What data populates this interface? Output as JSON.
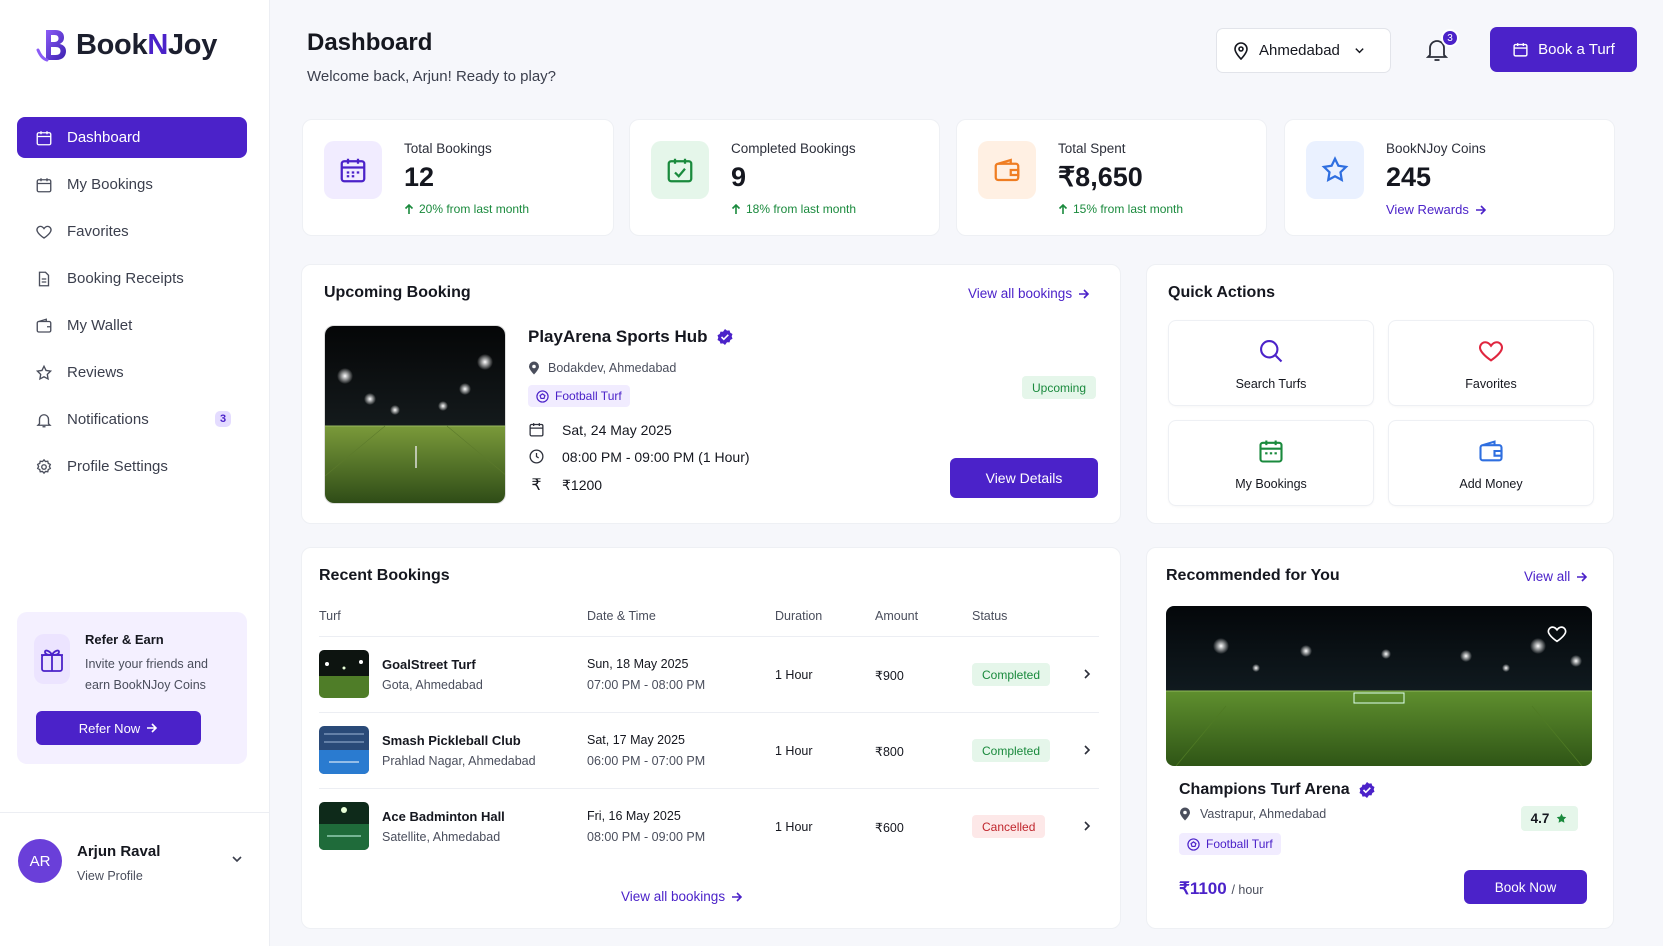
{
  "app": {
    "brand_prefix": "Book",
    "brand_n": "N",
    "brand_suffix": "Joy"
  },
  "sidebar": {
    "items": [
      {
        "label": "Dashboard",
        "icon": "calendar-icon"
      },
      {
        "label": "My Bookings",
        "icon": "calendar-icon"
      },
      {
        "label": "Favorites",
        "icon": "heart-icon"
      },
      {
        "label": "Booking Receipts",
        "icon": "receipt-icon"
      },
      {
        "label": "My Wallet",
        "icon": "wallet-icon"
      },
      {
        "label": "Reviews",
        "icon": "star-icon"
      },
      {
        "label": "Notifications",
        "icon": "bell-icon",
        "badge": "3"
      },
      {
        "label": "Profile Settings",
        "icon": "gear-icon"
      }
    ],
    "refer": {
      "title": "Refer & Earn",
      "text": "Invite your friends and earn BookNJoy Coins",
      "button": "Refer Now"
    },
    "user": {
      "initials": "AR",
      "name": "Arjun Raval",
      "link": "View Profile"
    }
  },
  "header": {
    "title": "Dashboard",
    "subtitle": "Welcome back, Arjun! Ready to play?",
    "location": "Ahmedabad",
    "notif_count": "3",
    "book_button": "Book a Turf"
  },
  "stats": [
    {
      "label": "Total Bookings",
      "value": "12",
      "change": "20% from last month"
    },
    {
      "label": "Completed Bookings",
      "value": "9",
      "change": "18% from last month"
    },
    {
      "label": "Total Spent",
      "value": "₹8,650",
      "change": "15% from last month"
    },
    {
      "label": "BookNJoy Coins",
      "value": "245",
      "link": "View Rewards"
    }
  ],
  "upcoming": {
    "title": "Upcoming Booking",
    "view_all": "View all bookings",
    "name": "PlayArena Sports Hub",
    "location": "Bodakdev, Ahmedabad",
    "tag": "Football Turf",
    "status": "Upcoming",
    "date": "Sat, 24 May 2025",
    "time": "08:00 PM - 09:00 PM (1 Hour)",
    "price": "₹1200",
    "button": "View Details"
  },
  "quick_actions": {
    "title": "Quick Actions",
    "items": [
      {
        "label": "Search Turfs",
        "icon": "search-icon"
      },
      {
        "label": "Favorites",
        "icon": "heart-icon"
      },
      {
        "label": "My Bookings",
        "icon": "calendar-icon"
      },
      {
        "label": "Add Money",
        "icon": "wallet-icon"
      }
    ]
  },
  "recent": {
    "title": "Recent Bookings",
    "columns": [
      "Turf",
      "Date & Time",
      "Duration",
      "Amount",
      "Status"
    ],
    "rows": [
      {
        "name": "GoalStreet Turf",
        "location": "Gota, Ahmedabad",
        "date": "Sun, 18 May 2025",
        "time": "07:00 PM - 08:00 PM",
        "duration": "1 Hour",
        "amount": "₹900",
        "status": "Completed"
      },
      {
        "name": "Smash Pickleball Club",
        "location": "Prahlad Nagar, Ahmedabad",
        "date": "Sat, 17 May 2025",
        "time": "06:00 PM - 07:00 PM",
        "duration": "1 Hour",
        "amount": "₹800",
        "status": "Completed"
      },
      {
        "name": "Ace Badminton Hall",
        "location": "Satellite, Ahmedabad",
        "date": "Fri, 16 May 2025",
        "time": "08:00 PM - 09:00 PM",
        "duration": "1 Hour",
        "amount": "₹600",
        "status": "Cancelled"
      }
    ],
    "view_all": "View all bookings"
  },
  "recommended": {
    "title": "Recommended for You",
    "view_all": "View all",
    "name": "Champions Turf Arena",
    "location": "Vastrapur, Ahmedabad",
    "tag": "Football Turf",
    "rating": "4.7",
    "price": "₹1100",
    "price_unit": "/ hour",
    "button": "Book Now"
  },
  "colors": {
    "accent": "#4b22c9",
    "success": "#1a8a3d",
    "danger": "#c0262d"
  }
}
